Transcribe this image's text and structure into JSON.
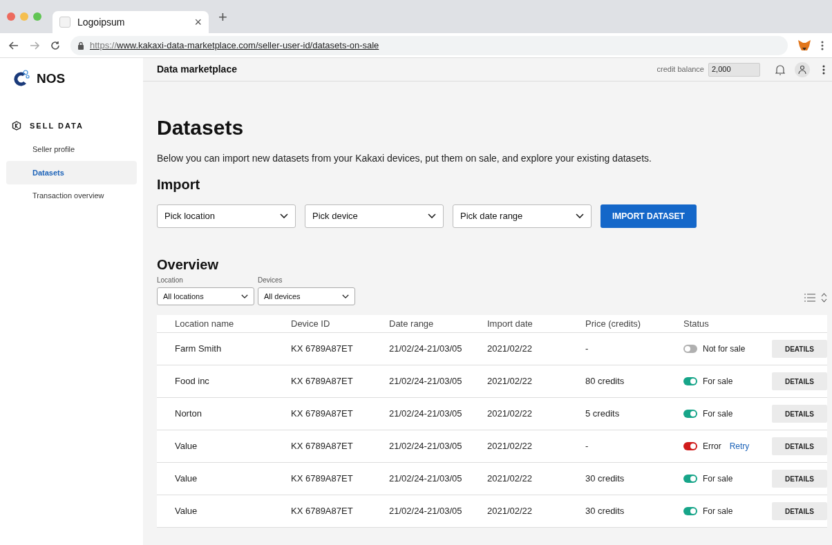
{
  "browser": {
    "tab_title": "Logoipsum",
    "tab_close": "×",
    "new_tab": "+",
    "url_scheme": "https://",
    "url_rest": "www.kakaxi-data-marketplace.com/seller-user-id/datasets-on-sale"
  },
  "sidebar": {
    "logo": "NOS",
    "section": "SELL DATA",
    "items": [
      {
        "label": "Seller profile",
        "selected": false
      },
      {
        "label": "Datasets",
        "selected": true
      },
      {
        "label": "Transaction overview",
        "selected": false
      }
    ]
  },
  "header": {
    "title": "Data marketplace",
    "credit_label": "credit balance",
    "credit_value": "2,000"
  },
  "page": {
    "title": "Datasets",
    "intro": "Below you can import new datasets from your Kakaxi devices, put them on sale, and explore your existing datasets.",
    "import_title": "Import",
    "import_selects": [
      "Pick location",
      "Pick device",
      "Pick date range"
    ],
    "import_button": "IMPORT DATASET",
    "overview_title": "Overview",
    "filters": [
      {
        "label": "Location",
        "value": "All locations"
      },
      {
        "label": "Devices",
        "value": "All devices"
      }
    ]
  },
  "table": {
    "columns": [
      "Location name",
      "Device ID",
      "Date range",
      "Import date",
      "Price (credits)",
      "Status"
    ],
    "rows": [
      {
        "cells": [
          "Farm Smith",
          "KX 6789A87ET",
          "21/02/24-21/03/05",
          "2021/02/22",
          "-"
        ],
        "kind": "off",
        "status": "Not for sale",
        "button": "DEATILS"
      },
      {
        "cells": [
          "Food inc",
          "KX 6789A87ET",
          "21/02/24-21/03/05",
          "2021/02/22",
          "80 credits"
        ],
        "kind": "on",
        "status": "For sale",
        "button": "DETAILS"
      },
      {
        "cells": [
          "Norton",
          "KX 6789A87ET",
          "21/02/24-21/03/05",
          "2021/02/22",
          "5 credits"
        ],
        "kind": "on",
        "status": "For sale",
        "button": "DETAILS"
      },
      {
        "cells": [
          "Value",
          "KX 6789A87ET",
          "21/02/24-21/03/05",
          "2021/02/22",
          "-"
        ],
        "kind": "error",
        "status": "Error",
        "retry": "Retry",
        "button": "DETAILS"
      },
      {
        "cells": [
          "Value",
          "KX 6789A87ET",
          "21/02/24-21/03/05",
          "2021/02/22",
          "30 credits"
        ],
        "kind": "on",
        "status": "For sale",
        "button": "DETAILS"
      },
      {
        "cells": [
          "Value",
          "KX 6789A87ET",
          "21/02/24-21/03/05",
          "2021/02/22",
          "30 credits"
        ],
        "kind": "on",
        "status": "For sale",
        "button": "DETAILS"
      }
    ]
  }
}
